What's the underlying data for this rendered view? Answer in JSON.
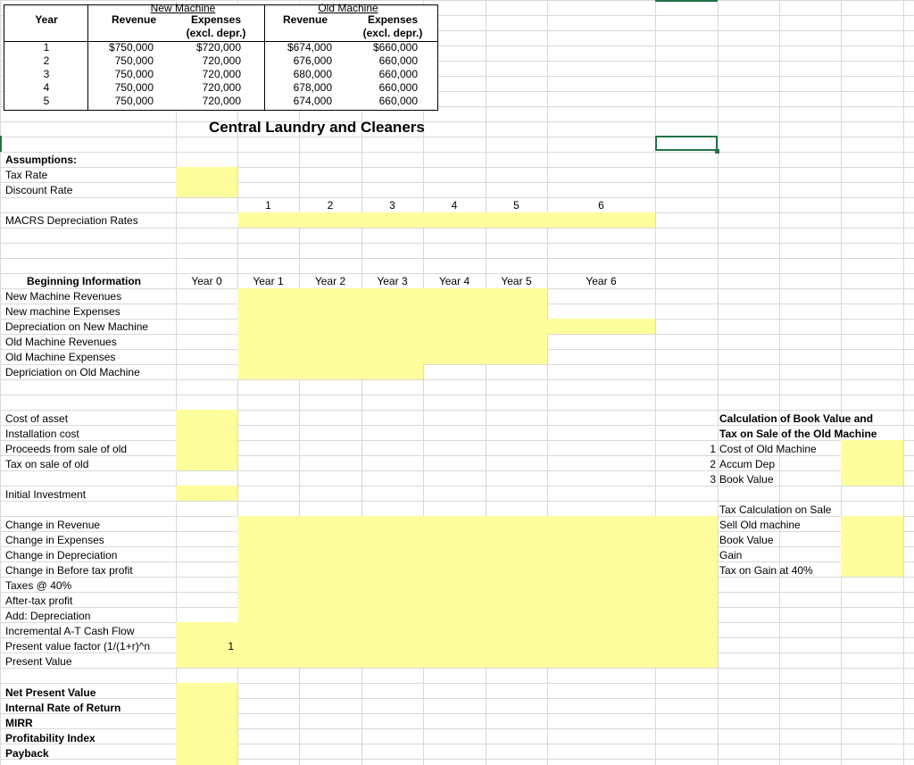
{
  "top_table": {
    "group_new": "New Machine",
    "group_old": "Old Machine",
    "headers": {
      "year": "Year",
      "revenue_new": "Revenue",
      "expenses_new_1": "Expenses",
      "expenses_new_2": "(excl. depr.)",
      "revenue_old": "Revenue",
      "expenses_old_1": "Expenses",
      "expenses_old_2": "(excl. depr.)"
    },
    "rows": [
      {
        "year": "1",
        "new_rev": "$750,000",
        "new_exp": "$720,000",
        "old_rev": "$674,000",
        "old_exp": "$660,000"
      },
      {
        "year": "2",
        "new_rev": "750,000",
        "new_exp": "720,000",
        "old_rev": "676,000",
        "old_exp": "660,000"
      },
      {
        "year": "3",
        "new_rev": "750,000",
        "new_exp": "720,000",
        "old_rev": "680,000",
        "old_exp": "660,000"
      },
      {
        "year": "4",
        "new_rev": "750,000",
        "new_exp": "720,000",
        "old_rev": "678,000",
        "old_exp": "660,000"
      },
      {
        "year": "5",
        "new_rev": "750,000",
        "new_exp": "720,000",
        "old_rev": "674,000",
        "old_exp": "660,000"
      }
    ]
  },
  "title": "Central Laundry and Cleaners",
  "assumptions": {
    "heading": "Assumptions:",
    "tax_rate": "Tax Rate",
    "discount_rate": "Discount Rate",
    "macrs_label": "MACRS Depreciation Rates",
    "macrs_years": [
      "1",
      "2",
      "3",
      "4",
      "5",
      "6"
    ]
  },
  "beginning": {
    "heading": "Beginning Information",
    "years": [
      "Year 0",
      "Year 1",
      "Year 2",
      "Year 3",
      "Year 4",
      "Year 5",
      "Year 6"
    ],
    "rows": [
      "New Machine Revenues",
      "New machine Expenses",
      "Depreciation on New Machine",
      "Old Machine Revenues",
      "Old Machine Expenses",
      "Depriciation on Old Machine"
    ]
  },
  "initial": {
    "rows": [
      "Cost of asset",
      "Installation cost",
      "Proceeds from sale of old",
      "Tax on sale of old"
    ],
    "initial_investment": "Initial Investment"
  },
  "changes": {
    "rows": [
      "Change in Revenue",
      "Change in Expenses",
      "Change in Depreciation",
      "Change in Before tax profit",
      "Taxes @ 40%",
      "After-tax profit",
      "Add: Depreciation",
      "Incremental A-T Cash Flow",
      "Present value factor (1/(1+r)^n",
      "Present Value"
    ],
    "pv_factor_year0": "1"
  },
  "summary": {
    "rows": [
      "Net Present Value",
      "Internal Rate of Return",
      "MIRR",
      "Profitability Index",
      "Payback"
    ]
  },
  "book_value": {
    "heading_1": "Calculation of Book Value and",
    "heading_2": "Tax on Sale of the Old Machine",
    "items": [
      {
        "num": "1",
        "label": "Cost of Old Machine"
      },
      {
        "num": "2",
        "label": "Accum Dep"
      },
      {
        "num": "3",
        "label": "Book Value"
      }
    ],
    "tax_calc_heading": "Tax Calculation on Sale",
    "tax_items": [
      "Sell Old machine",
      "Book Value",
      "Gain",
      "Tax on Gain at 40%"
    ]
  },
  "colors": {
    "input_fill": "#fefe9c",
    "gridline": "#d9d9d9",
    "selection": "#217346"
  }
}
